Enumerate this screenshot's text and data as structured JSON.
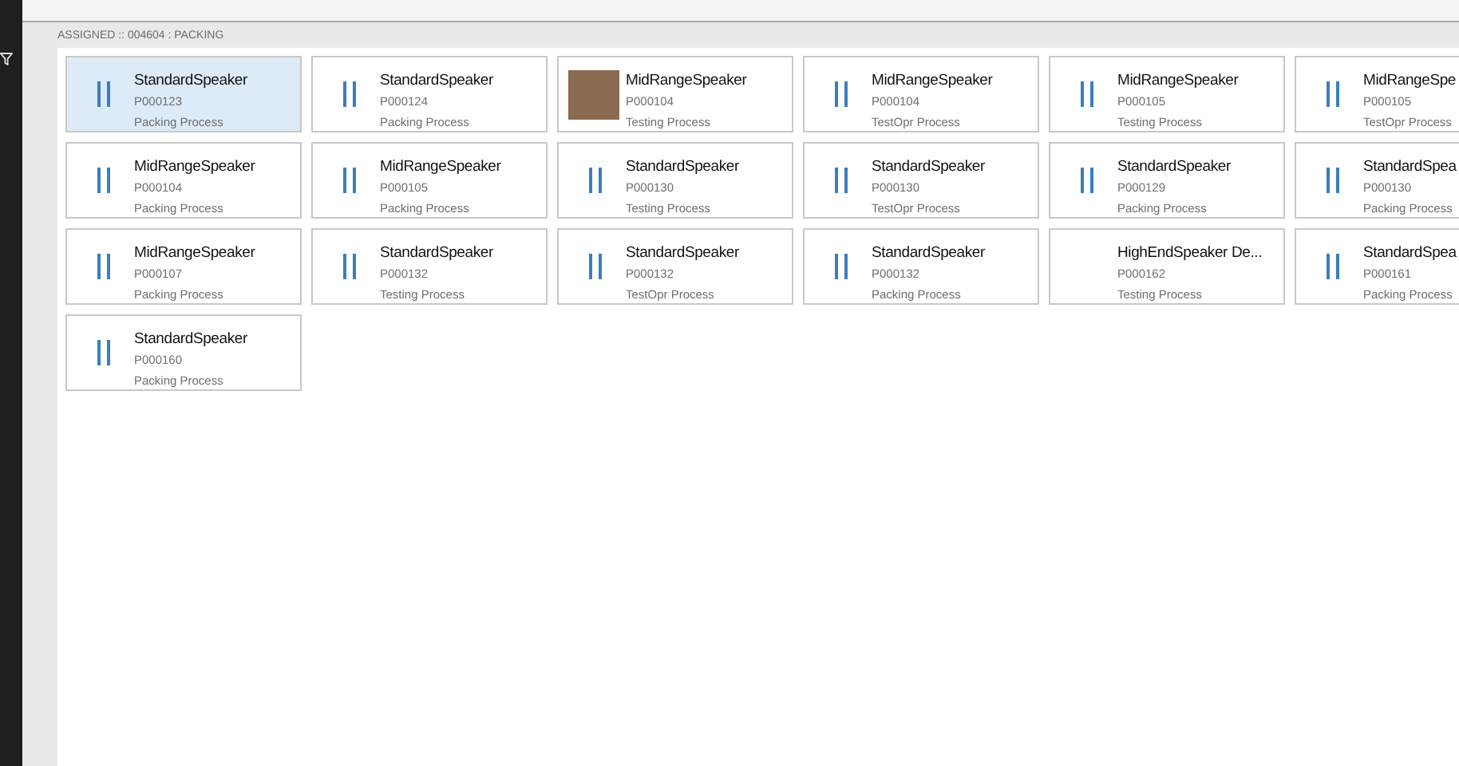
{
  "group": {
    "header": "ASSIGNED :: 004604 : PACKING",
    "cards": [
      {
        "title": "StandardSpeaker",
        "order": "P000123",
        "process": "Packing Process",
        "kind": "paused",
        "selected": true
      },
      {
        "title": "StandardSpeaker",
        "order": "P000124",
        "process": "Packing Process",
        "kind": "paused",
        "selected": false
      },
      {
        "title": "MidRangeSpeaker",
        "order": "P000104",
        "process": "Testing Process",
        "kind": "photo",
        "selected": false
      },
      {
        "title": "MidRangeSpeaker",
        "order": "P000104",
        "process": "TestOpr Process",
        "kind": "paused",
        "selected": false
      },
      {
        "title": "MidRangeSpeaker",
        "order": "P000105",
        "process": "Testing Process",
        "kind": "paused",
        "selected": false
      },
      {
        "title": "MidRangeSpe",
        "order": "P000105",
        "process": "TestOpr Process",
        "kind": "paused",
        "selected": false
      },
      {
        "title": "MidRangeSpeaker",
        "order": "P000104",
        "process": "Packing Process",
        "kind": "paused",
        "selected": false
      },
      {
        "title": "MidRangeSpeaker",
        "order": "P000105",
        "process": "Packing Process",
        "kind": "paused",
        "selected": false
      },
      {
        "title": "StandardSpeaker",
        "order": "P000130",
        "process": "Testing Process",
        "kind": "paused",
        "selected": false
      },
      {
        "title": "StandardSpeaker",
        "order": "P000130",
        "process": "TestOpr Process",
        "kind": "paused",
        "selected": false
      },
      {
        "title": "StandardSpeaker",
        "order": "P000129",
        "process": "Packing Process",
        "kind": "paused",
        "selected": false
      },
      {
        "title": "StandardSpea",
        "order": "P000130",
        "process": "Packing Process",
        "kind": "paused",
        "selected": false
      },
      {
        "title": "MidRangeSpeaker",
        "order": "P000107",
        "process": "Packing Process",
        "kind": "paused",
        "selected": false
      },
      {
        "title": "StandardSpeaker",
        "order": "P000132",
        "process": "Testing Process",
        "kind": "paused",
        "selected": false
      },
      {
        "title": "StandardSpeaker",
        "order": "P000132",
        "process": "TestOpr Process",
        "kind": "paused",
        "selected": false
      },
      {
        "title": "StandardSpeaker",
        "order": "P000132",
        "process": "Packing Process",
        "kind": "paused",
        "selected": false
      },
      {
        "title": "HighEndSpeaker De...",
        "order": "P000162",
        "process": "Testing Process",
        "kind": "plain",
        "selected": false
      },
      {
        "title": "StandardSpea",
        "order": "P000161",
        "process": "Packing Process",
        "kind": "paused",
        "selected": false
      },
      {
        "title": "StandardSpeaker",
        "order": "P000160",
        "process": "Packing Process",
        "kind": "paused",
        "selected": false
      }
    ]
  }
}
